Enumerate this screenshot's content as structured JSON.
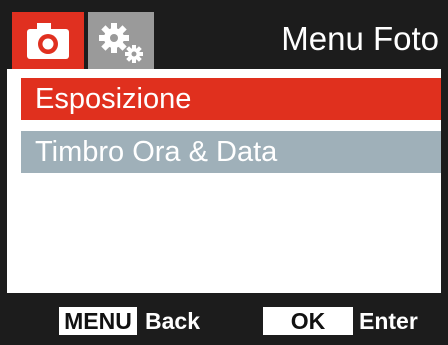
{
  "header": {
    "title": "Menu Foto",
    "tabs": [
      {
        "icon": "camera-icon",
        "active": true
      },
      {
        "icon": "gears-icon",
        "active": false
      }
    ]
  },
  "menu": {
    "items": [
      {
        "label": "Esposizione",
        "selected": true
      },
      {
        "label": "Timbro Ora & Data",
        "selected": false
      }
    ]
  },
  "footer": {
    "menu_key": "MENU",
    "back_label": "Back",
    "ok_key": "OK",
    "enter_label": "Enter"
  },
  "colors": {
    "accent": "#e0301e",
    "inactive_item": "#9fb0b9",
    "background": "#1c1c1c"
  }
}
